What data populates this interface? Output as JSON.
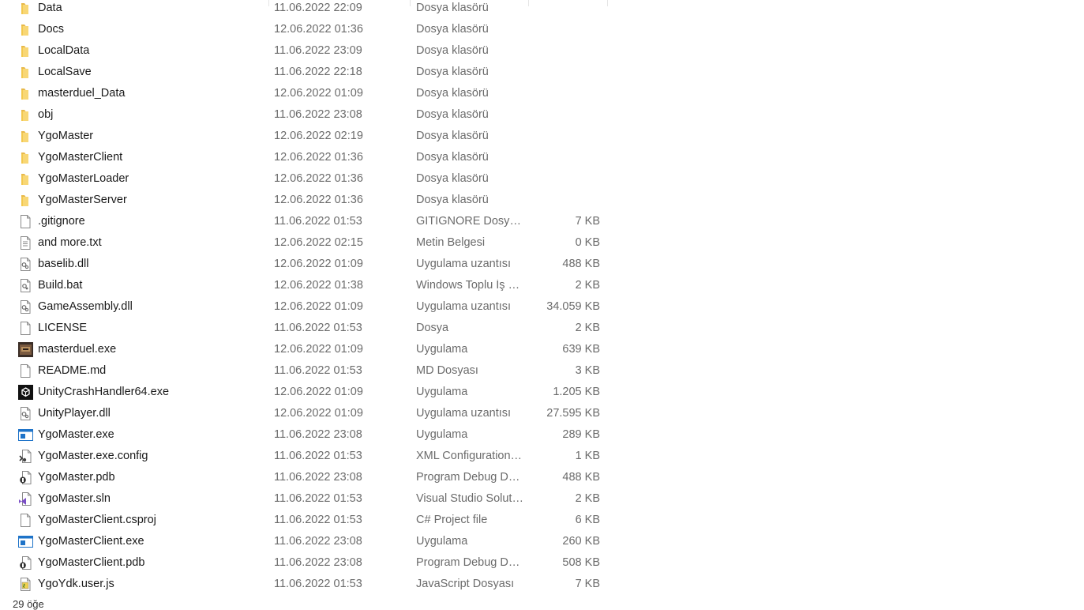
{
  "files": [
    {
      "name": "Data",
      "date": "11.06.2022 22:09",
      "type": "Dosya klasörü",
      "size": "",
      "icon": "folder-icon"
    },
    {
      "name": "Docs",
      "date": "12.06.2022 01:36",
      "type": "Dosya klasörü",
      "size": "",
      "icon": "folder-icon"
    },
    {
      "name": "LocalData",
      "date": "11.06.2022 23:09",
      "type": "Dosya klasörü",
      "size": "",
      "icon": "folder-icon"
    },
    {
      "name": "LocalSave",
      "date": "11.06.2022 22:18",
      "type": "Dosya klasörü",
      "size": "",
      "icon": "folder-icon"
    },
    {
      "name": "masterduel_Data",
      "date": "12.06.2022 01:09",
      "type": "Dosya klasörü",
      "size": "",
      "icon": "folder-icon"
    },
    {
      "name": "obj",
      "date": "11.06.2022 23:08",
      "type": "Dosya klasörü",
      "size": "",
      "icon": "folder-icon"
    },
    {
      "name": "YgoMaster",
      "date": "12.06.2022 02:19",
      "type": "Dosya klasörü",
      "size": "",
      "icon": "folder-icon"
    },
    {
      "name": "YgoMasterClient",
      "date": "12.06.2022 01:36",
      "type": "Dosya klasörü",
      "size": "",
      "icon": "folder-icon"
    },
    {
      "name": "YgoMasterLoader",
      "date": "12.06.2022 01:36",
      "type": "Dosya klasörü",
      "size": "",
      "icon": "folder-icon"
    },
    {
      "name": "YgoMasterServer",
      "date": "12.06.2022 01:36",
      "type": "Dosya klasörü",
      "size": "",
      "icon": "folder-icon"
    },
    {
      "name": ".gitignore",
      "date": "11.06.2022 01:53",
      "type": "GITIGNORE Dosyası",
      "size": "7 KB",
      "icon": "blank-file-icon"
    },
    {
      "name": "and more.txt",
      "date": "12.06.2022 02:15",
      "type": "Metin Belgesi",
      "size": "0 KB",
      "icon": "text-file-icon"
    },
    {
      "name": "baselib.dll",
      "date": "12.06.2022 01:09",
      "type": "Uygulama uzantısı",
      "size": "488 KB",
      "icon": "dll-file-icon"
    },
    {
      "name": "Build.bat",
      "date": "12.06.2022 01:38",
      "type": "Windows Toplu İş …",
      "size": "2 KB",
      "icon": "batch-file-icon"
    },
    {
      "name": "GameAssembly.dll",
      "date": "12.06.2022 01:09",
      "type": "Uygulama uzantısı",
      "size": "34.059 KB",
      "icon": "dll-file-icon"
    },
    {
      "name": "LICENSE",
      "date": "11.06.2022 01:53",
      "type": "Dosya",
      "size": "2 KB",
      "icon": "blank-file-icon"
    },
    {
      "name": "masterduel.exe",
      "date": "12.06.2022 01:09",
      "type": "Uygulama",
      "size": "639 KB",
      "icon": "game-app-icon"
    },
    {
      "name": "README.md",
      "date": "11.06.2022 01:53",
      "type": "MD Dosyası",
      "size": "3 KB",
      "icon": "blank-file-icon"
    },
    {
      "name": "UnityCrashHandler64.exe",
      "date": "12.06.2022 01:09",
      "type": "Uygulama",
      "size": "1.205 KB",
      "icon": "unity-app-icon"
    },
    {
      "name": "UnityPlayer.dll",
      "date": "12.06.2022 01:09",
      "type": "Uygulama uzantısı",
      "size": "27.595 KB",
      "icon": "dll-file-icon"
    },
    {
      "name": "YgoMaster.exe",
      "date": "11.06.2022 23:08",
      "type": "Uygulama",
      "size": "289 KB",
      "icon": "window-app-icon"
    },
    {
      "name": "YgoMaster.exe.config",
      "date": "11.06.2022 01:53",
      "type": "XML Configuration…",
      "size": "1 KB",
      "icon": "config-file-icon"
    },
    {
      "name": "YgoMaster.pdb",
      "date": "11.06.2022 23:08",
      "type": "Program Debug D…",
      "size": "488 KB",
      "icon": "pdb-file-icon"
    },
    {
      "name": "YgoMaster.sln",
      "date": "11.06.2022 01:53",
      "type": "Visual Studio Solut…",
      "size": "2 KB",
      "icon": "vs-solution-icon"
    },
    {
      "name": "YgoMasterClient.csproj",
      "date": "11.06.2022 01:53",
      "type": "C# Project file",
      "size": "6 KB",
      "icon": "blank-file-icon"
    },
    {
      "name": "YgoMasterClient.exe",
      "date": "11.06.2022 23:08",
      "type": "Uygulama",
      "size": "260 KB",
      "icon": "window-app-icon"
    },
    {
      "name": "YgoMasterClient.pdb",
      "date": "11.06.2022 23:08",
      "type": "Program Debug D…",
      "size": "508 KB",
      "icon": "pdb-file-icon"
    },
    {
      "name": "YgoYdk.user.js",
      "date": "11.06.2022 01:53",
      "type": "JavaScript Dosyası",
      "size": "7 KB",
      "icon": "js-file-icon"
    }
  ],
  "status": {
    "item_count": "29 öğe"
  },
  "colors": {
    "folder": "#f8d775",
    "folder_dark": "#e8b94a",
    "text_secondary": "#6b6b6b",
    "exe_blue": "#1e73c8"
  }
}
